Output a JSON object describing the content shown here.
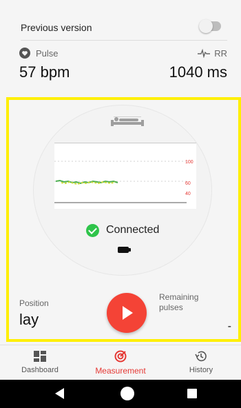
{
  "top": {
    "previous_version_label": "Previous version",
    "previous_version_enabled": false,
    "pulse": {
      "label": "Pulse",
      "value": "57 bpm",
      "icon": "heart-icon"
    },
    "rr": {
      "label": "RR",
      "value": "1040 ms",
      "icon": "ecg-wave-icon"
    }
  },
  "measurement": {
    "position_icon": "lying-person-icon",
    "plot": {
      "y_ticks": [
        "100",
        "60",
        "40"
      ],
      "accent_color": "#e53935",
      "trace_colors": [
        "#4caf50",
        "#cddc39"
      ]
    },
    "status": {
      "text": "Connected",
      "color": "#2ec44a",
      "icon": "check-circle-icon"
    },
    "battery_icon": "battery-icon",
    "position": {
      "label": "Position",
      "value": "lay"
    },
    "remaining": {
      "label": "Remaining pulses",
      "value": "-"
    },
    "play_button_icon": "play-icon",
    "play_button_color": "#f44336"
  },
  "nav": {
    "items": [
      {
        "label": "Dashboard",
        "icon": "dashboard-icon",
        "active": false
      },
      {
        "label": "Measurement",
        "icon": "measurement-target-icon",
        "active": true
      },
      {
        "label": "History",
        "icon": "history-icon",
        "active": false
      }
    ],
    "active_color": "#e53935"
  },
  "system": {
    "back_icon": "back-icon",
    "home_icon": "home-icon",
    "recents_icon": "recents-icon"
  }
}
